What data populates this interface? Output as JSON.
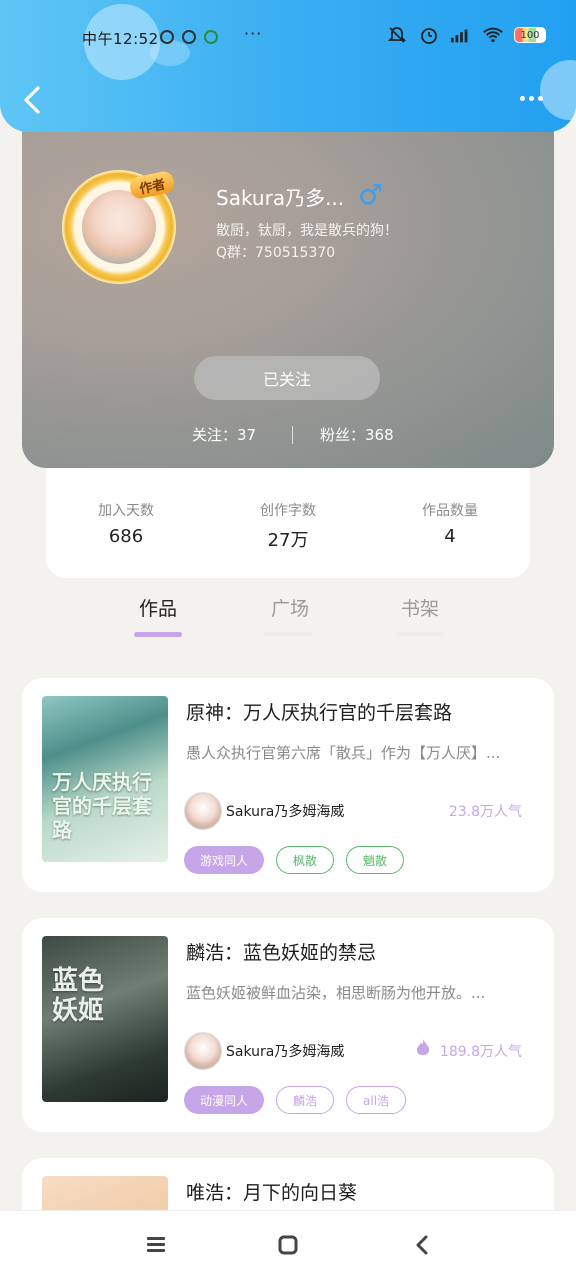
{
  "status_bar": {
    "time": "中午12:52",
    "dots": "···",
    "battery": "100"
  },
  "header": {
    "back_icon": "chevron-left-icon",
    "more_icon": "more-dots-icon"
  },
  "profile": {
    "badge": "作者",
    "name": "Sakura乃多...",
    "gender_symbol": "♂",
    "bio_line1": "散厨，钛厨，我是散兵的狗！",
    "bio_line2": "Q群：750515370",
    "follow_button": "已关注",
    "following": "关注：37",
    "fans": "粉丝：368"
  },
  "stats": [
    {
      "label": "加入天数",
      "value": "686"
    },
    {
      "label": "创作字数",
      "value": "27万"
    },
    {
      "label": "作品数量",
      "value": "4"
    }
  ],
  "tabs": [
    {
      "label": "作品",
      "active": true
    },
    {
      "label": "广场",
      "active": false
    },
    {
      "label": "书架",
      "active": false
    }
  ],
  "books": [
    {
      "title": "原神：万人厌执行官的千层套路",
      "cover_text": "万人厌执行官的千层套路",
      "desc": "愚人众执行官第六席「散兵」作为【万人厌】...",
      "author": "Sakura乃多姆海威",
      "popularity": "23.8万人气",
      "tags": [
        "游戏同人",
        "枫散",
        "魈散"
      ]
    },
    {
      "title": "麟浩：蓝色妖姬的禁忌",
      "cover_text": "蓝色妖姬",
      "desc": "蓝色妖姬被鲜血沾染，相思断肠为他开放。...",
      "author": "Sakura乃多姆海威",
      "popularity": "189.8万人气",
      "tags": [
        "动漫同人",
        "麟浩",
        "all浩"
      ]
    },
    {
      "title": "唯浩：月下的向日葵"
    }
  ],
  "colors": {
    "accent": "#c6a6e8",
    "header_blue": "#3aaef2",
    "tag_green": "#5cb86a"
  }
}
